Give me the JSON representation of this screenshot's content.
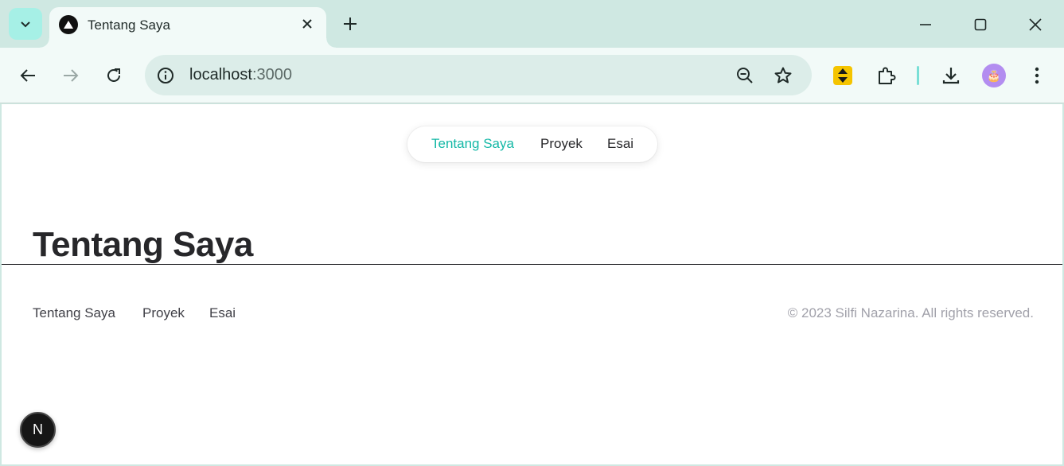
{
  "browser": {
    "tab": {
      "title": "Tentang Saya",
      "favicon": "triangle-icon"
    },
    "omnibox": {
      "host": "localhost",
      "port": ":3000"
    },
    "avatar_emoji": "🎂",
    "accent_color": "#14b8a6"
  },
  "page": {
    "nav": [
      {
        "label": "Tentang Saya",
        "active": true
      },
      {
        "label": "Proyek",
        "active": false
      },
      {
        "label": "Esai",
        "active": false
      }
    ],
    "heading": "Tentang Saya",
    "footer": {
      "links": [
        {
          "label": "Tentang Saya"
        },
        {
          "label": "Proyek"
        },
        {
          "label": "Esai"
        }
      ],
      "copyright": "© 2023 Silfi Nazarina. All rights reserved."
    },
    "dev_badge": "N"
  }
}
